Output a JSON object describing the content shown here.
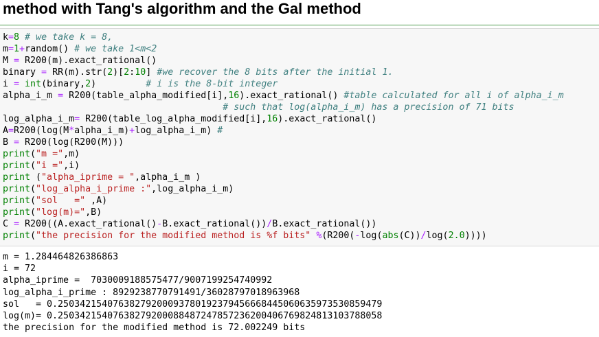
{
  "page": {
    "title": "method with Tang's algorithm and the Gal method"
  },
  "code_lines": [
    [
      {
        "t": "k",
        "c": ""
      },
      {
        "t": "=",
        "c": "op"
      },
      {
        "t": "8",
        "c": "nm"
      },
      {
        "t": " # we take k = 8,",
        "c": "cm"
      }
    ],
    [
      {
        "t": "m",
        "c": ""
      },
      {
        "t": "=",
        "c": "op"
      },
      {
        "t": "1",
        "c": "nm"
      },
      {
        "t": "+",
        "c": "op"
      },
      {
        "t": "random() ",
        "c": ""
      },
      {
        "t": "# we take 1<m<2",
        "c": "cm"
      }
    ],
    [
      {
        "t": "M ",
        "c": ""
      },
      {
        "t": "=",
        "c": "op"
      },
      {
        "t": " R200(m).exact_rational()",
        "c": ""
      }
    ],
    [
      {
        "t": "binary ",
        "c": ""
      },
      {
        "t": "=",
        "c": "op"
      },
      {
        "t": " RR(m).str(",
        "c": ""
      },
      {
        "t": "2",
        "c": "nm"
      },
      {
        "t": ")[",
        "c": ""
      },
      {
        "t": "2",
        "c": "nm"
      },
      {
        "t": ":",
        "c": ""
      },
      {
        "t": "10",
        "c": "nm"
      },
      {
        "t": "] ",
        "c": ""
      },
      {
        "t": "#we recover the 8 bits after the initial 1.",
        "c": "cm"
      }
    ],
    [
      {
        "t": "i ",
        "c": ""
      },
      {
        "t": "=",
        "c": "op"
      },
      {
        "t": " ",
        "c": ""
      },
      {
        "t": "int",
        "c": "fn"
      },
      {
        "t": "(binary,",
        "c": ""
      },
      {
        "t": "2",
        "c": "nm"
      },
      {
        "t": ")         ",
        "c": ""
      },
      {
        "t": "# i is the 8-bit integer",
        "c": "cm"
      }
    ],
    [
      {
        "t": "alpha_i_m ",
        "c": ""
      },
      {
        "t": "=",
        "c": "op"
      },
      {
        "t": " R200(table_alpha_modified[i],",
        "c": ""
      },
      {
        "t": "16",
        "c": "nm"
      },
      {
        "t": ").exact_rational() ",
        "c": ""
      },
      {
        "t": "#table calculated for all i of alpha_i_m",
        "c": "cm"
      }
    ],
    [
      {
        "t": "                                        ",
        "c": ""
      },
      {
        "t": "# such that log(alpha_i_m) has a precision of 71 bits",
        "c": "cm"
      }
    ],
    [
      {
        "t": "log_alpha_i_m",
        "c": ""
      },
      {
        "t": "=",
        "c": "op"
      },
      {
        "t": " R200(table_log_alpha_modified[i],",
        "c": ""
      },
      {
        "t": "16",
        "c": "nm"
      },
      {
        "t": ").exact_rational()",
        "c": ""
      }
    ],
    [
      {
        "t": "A",
        "c": ""
      },
      {
        "t": "=",
        "c": "op"
      },
      {
        "t": "R200(log(M",
        "c": ""
      },
      {
        "t": "*",
        "c": "op"
      },
      {
        "t": "alpha_i_m)",
        "c": ""
      },
      {
        "t": "+",
        "c": "op"
      },
      {
        "t": "log_alpha_i_m) ",
        "c": ""
      },
      {
        "t": "#",
        "c": "cm"
      }
    ],
    [
      {
        "t": "B ",
        "c": ""
      },
      {
        "t": "=",
        "c": "op"
      },
      {
        "t": " R200(log(R200(M)))",
        "c": ""
      }
    ],
    [
      {
        "t": "print",
        "c": "kw"
      },
      {
        "t": "(",
        "c": ""
      },
      {
        "t": "\"m =\"",
        "c": "st"
      },
      {
        "t": ",m)",
        "c": ""
      }
    ],
    [
      {
        "t": "print",
        "c": "kw"
      },
      {
        "t": "(",
        "c": ""
      },
      {
        "t": "\"i =\"",
        "c": "st"
      },
      {
        "t": ",i)",
        "c": ""
      }
    ],
    [
      {
        "t": "print",
        "c": "kw"
      },
      {
        "t": " (",
        "c": ""
      },
      {
        "t": "\"alpha_iprime = \"",
        "c": "st"
      },
      {
        "t": ",alpha_i_m )",
        "c": ""
      }
    ],
    [
      {
        "t": "print",
        "c": "kw"
      },
      {
        "t": "(",
        "c": ""
      },
      {
        "t": "\"log_alpha_i_prime :\"",
        "c": "st"
      },
      {
        "t": ",log_alpha_i_m)",
        "c": ""
      }
    ],
    [
      {
        "t": "print",
        "c": "kw"
      },
      {
        "t": "(",
        "c": ""
      },
      {
        "t": "\"sol   =\"",
        "c": "st"
      },
      {
        "t": " ,A)",
        "c": ""
      }
    ],
    [
      {
        "t": "print",
        "c": "kw"
      },
      {
        "t": "(",
        "c": ""
      },
      {
        "t": "\"log(m)=\"",
        "c": "st"
      },
      {
        "t": ",B)",
        "c": ""
      }
    ],
    [
      {
        "t": "C ",
        "c": ""
      },
      {
        "t": "=",
        "c": "op"
      },
      {
        "t": " R200((A.exact_rational()",
        "c": ""
      },
      {
        "t": "-",
        "c": "op"
      },
      {
        "t": "B.exact_rational())",
        "c": ""
      },
      {
        "t": "/",
        "c": "op"
      },
      {
        "t": "B.exact_rational())",
        "c": ""
      }
    ],
    [
      {
        "t": "print",
        "c": "kw"
      },
      {
        "t": "(",
        "c": ""
      },
      {
        "t": "\"the precision for the modified method is %f bits\"",
        "c": "st"
      },
      {
        "t": " ",
        "c": ""
      },
      {
        "t": "%",
        "c": "op"
      },
      {
        "t": "(R200(",
        "c": ""
      },
      {
        "t": "-",
        "c": "op"
      },
      {
        "t": "log(",
        "c": ""
      },
      {
        "t": "abs",
        "c": "fn"
      },
      {
        "t": "(C))",
        "c": ""
      },
      {
        "t": "/",
        "c": "op"
      },
      {
        "t": "log(",
        "c": ""
      },
      {
        "t": "2.0",
        "c": "nm"
      },
      {
        "t": "))))",
        "c": ""
      }
    ]
  ],
  "output_lines": [
    "m = 1.284464826386863",
    "i = 72",
    "alpha_iprime =  7030009188575477/9007199254740992",
    "log_alpha_i_prime : 8929238770791491/36028797018963968",
    "sol   = 0.25034215407638279200093780192379456668445060635973530859479",
    "log(m)= 0.25034215407638279200088487247857236200406769824813103788058",
    "the precision for the modified method is 72.002249 bits"
  ]
}
